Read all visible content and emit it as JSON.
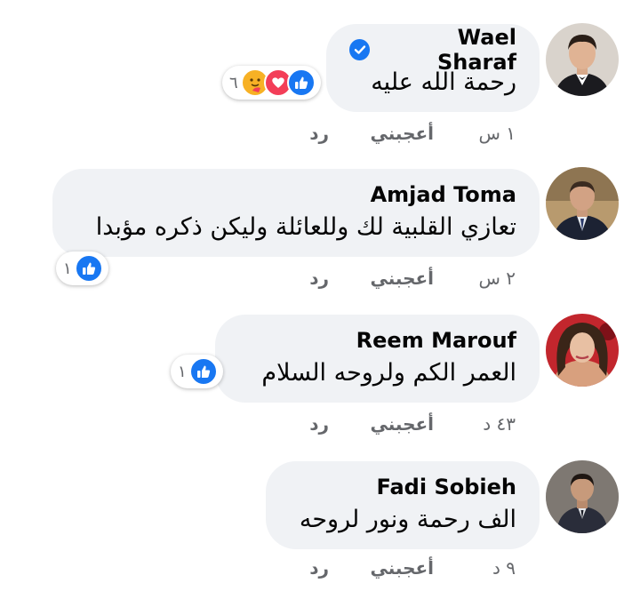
{
  "comments": [
    {
      "author": "Wael Sharaf",
      "verified": true,
      "text": "رحمة الله عليه",
      "reactions": {
        "icons": [
          "like-icon",
          "love-icon",
          "care-icon"
        ],
        "count": "٦"
      },
      "time": "١ س",
      "like_label": "أعجبني",
      "reply_label": "رد"
    },
    {
      "author": "Amjad Toma",
      "verified": false,
      "text": "تعازي القلبية لك وللعائلة وليكن ذكره مؤبدا",
      "reactions": {
        "icons": [
          "like-icon"
        ],
        "count": "١"
      },
      "time": "٢ س",
      "like_label": "أعجبني",
      "reply_label": "رد"
    },
    {
      "author": "Reem Marouf",
      "verified": false,
      "text": "العمر الكم ولروحه  السلام",
      "reactions": {
        "icons": [
          "like-icon"
        ],
        "count": "١"
      },
      "time": "٤٣ د",
      "like_label": "أعجبني",
      "reply_label": "رد"
    },
    {
      "author": "Fadi Sobieh",
      "verified": false,
      "text": "الف رحمة ونور لروحه",
      "reactions": null,
      "time": "٩ د",
      "like_label": "أعجبني",
      "reply_label": "رد"
    }
  ],
  "colors": {
    "bubble": "#f0f2f5",
    "meta_text": "#65676b",
    "like_blue": "#1877f2",
    "love_red": "#f33e58",
    "care_yellow": "#f7b125"
  }
}
